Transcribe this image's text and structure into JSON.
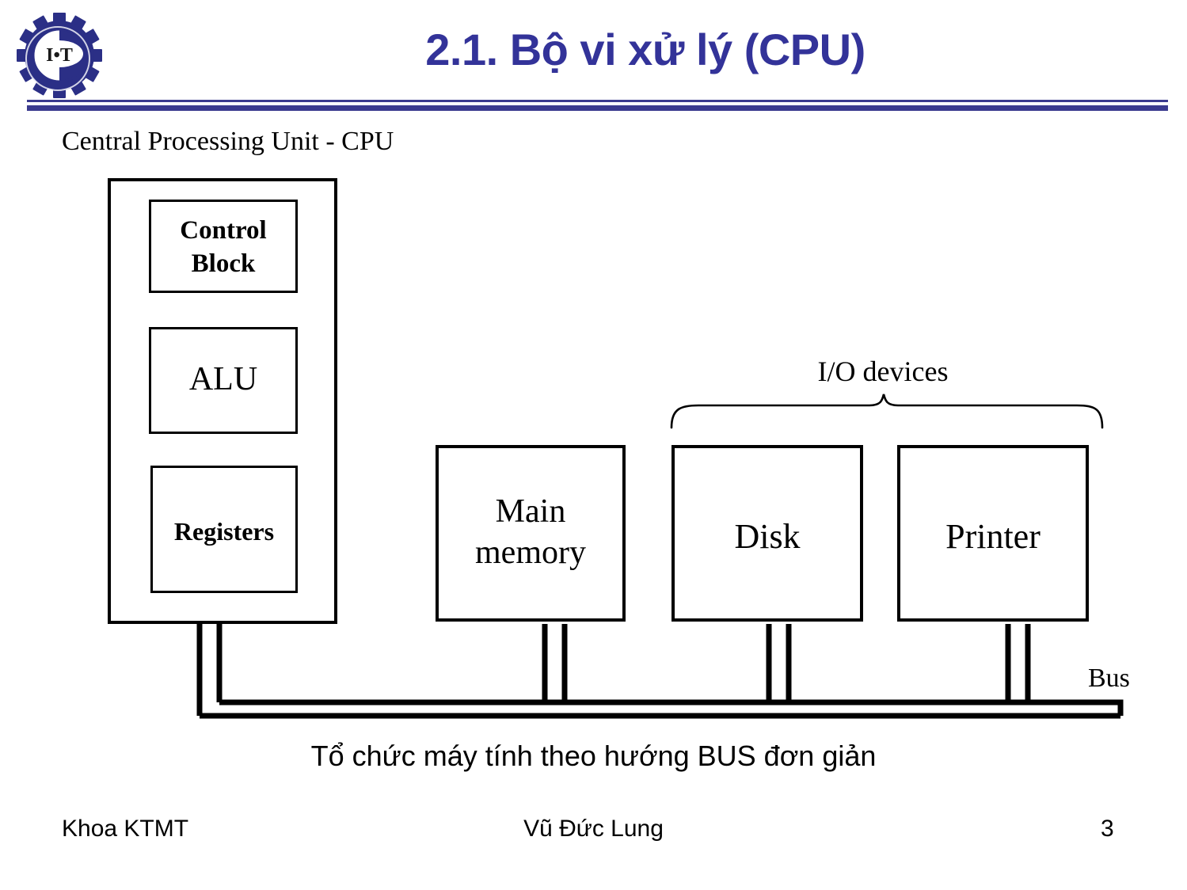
{
  "header": {
    "title": "2.1. Bộ vi xử lý (CPU)",
    "logo_icon": "gear-logo-icon",
    "logo_text": "I•T",
    "accent_color": "#333399",
    "divider_color": "#3b3b8f"
  },
  "body": {
    "subtitle": "Central Processing Unit - CPU",
    "caption": "Tổ chức máy tính theo hướng BUS đơn giản"
  },
  "diagram": {
    "cpu": {
      "blocks": [
        {
          "label": "Control Block",
          "name": "control-block"
        },
        {
          "label": "ALU",
          "name": "alu-block"
        },
        {
          "label": "Registers",
          "name": "registers-block"
        }
      ]
    },
    "peripherals": [
      {
        "label": "Main memory",
        "name": "main-memory"
      },
      {
        "label": "Disk",
        "name": "disk"
      },
      {
        "label": "Printer",
        "name": "printer"
      }
    ],
    "io_group_label": "I/O devices",
    "bus_label": "Bus",
    "line_color": "#000000"
  },
  "footer": {
    "left": "Khoa KTMT",
    "center": "Vũ Đức Lung",
    "page": "3"
  }
}
